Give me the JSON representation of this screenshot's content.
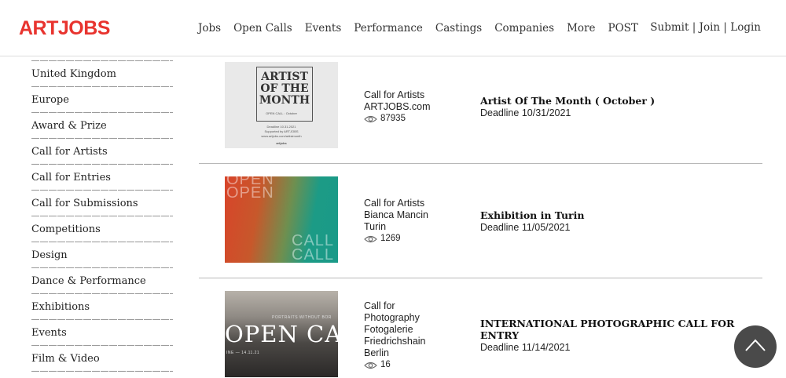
{
  "header": {
    "logo": "ARTJOBS",
    "nav": [
      "Jobs",
      "Open Calls",
      "Events",
      "Performance",
      "Castings",
      "Companies",
      "More",
      "POST"
    ],
    "auth": {
      "submit": "Submit",
      "join": "Join",
      "login": "Login",
      "separator": " | "
    }
  },
  "sidebar": {
    "dashes": "——————————————————",
    "items": [
      "United Kingdom",
      "Europe",
      "Award & Prize",
      "Call for Artists",
      "Call for Entries",
      "Call for Submissions",
      "Competitions",
      "Design",
      "Dance & Performance",
      "Exhibitions",
      "Events",
      "Film & Video"
    ]
  },
  "listings": [
    {
      "category": "Call for Artists",
      "org": "ARTJOBS.com",
      "location": "",
      "views": "87935",
      "title": "Artist Of The Month ( October )",
      "deadline": "Deadline 10/31/2021",
      "thumb": {
        "title": "ARTIST OF THE MONTH",
        "line1": "OPEN CALL : October",
        "line2": "Deadline 10.31.2021",
        "line3": "Supported by ARTJOBS",
        "line4": "www.artjobs.com/artistmonth",
        "logo": "artjobs"
      }
    },
    {
      "category": "Call for Artists",
      "org": "Bianca Mancin",
      "location": "Turin",
      "views": "1269",
      "title": "Exhibition in Turin",
      "deadline": "Deadline 11/05/2021",
      "thumb": {
        "top": "OPEN",
        "bottom": "CALL"
      }
    },
    {
      "category": "Call for Photography",
      "org": "Fotogalerie Friedrichshain",
      "location": "Berlin",
      "views": "16",
      "title": "INTERNATIONAL PHOTOGRAPHIC CALL FOR ENTRY",
      "deadline": "Deadline 11/14/2021",
      "thumb": {
        "subtitle": "PORTRAITS WITHOUT BOR",
        "headline": "OPEN CALL",
        "date": "INE — 14.11.21"
      }
    }
  ],
  "colors": {
    "logo": "#e8342f",
    "scroll_button": "#4a4a4a"
  },
  "icons": {
    "views": "eye-icon",
    "scroll_top": "chevron-up-icon"
  }
}
